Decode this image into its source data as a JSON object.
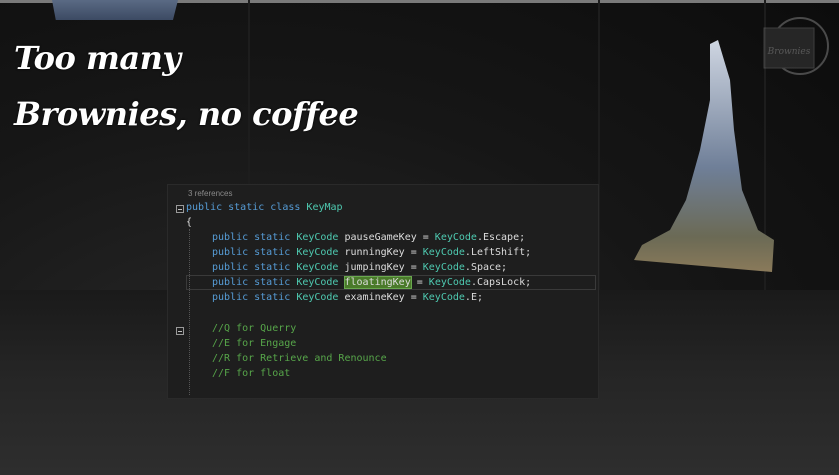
{
  "overlay": {
    "title_line1": "Too many",
    "title_line2": "Brownies, no coffee",
    "watermark": "Brownies"
  },
  "code": {
    "references": "3 references",
    "lines": [
      "public static class KeyMap",
      "{",
      "public static KeyCode pauseGameKey = KeyCode.Escape;",
      "public static KeyCode runningKey = KeyCode.LeftShift;",
      "public static KeyCode jumpingKey = KeyCode.Space;",
      "public static KeyCode floatingKey = KeyCode.CapsLock;",
      "public static KeyCode examineKey = KeyCode.E;",
      "",
      "//Q for Querry",
      "//E for Engage",
      "//R for Retrieve and Renounce",
      "//F for float"
    ],
    "highlighted_identifier": "floatingKey",
    "colors": {
      "keyword": "#569cd6",
      "type": "#4ec9b0",
      "comment": "#57a64a",
      "text": "#dcdcdc",
      "background": "#1e1e1e"
    }
  }
}
